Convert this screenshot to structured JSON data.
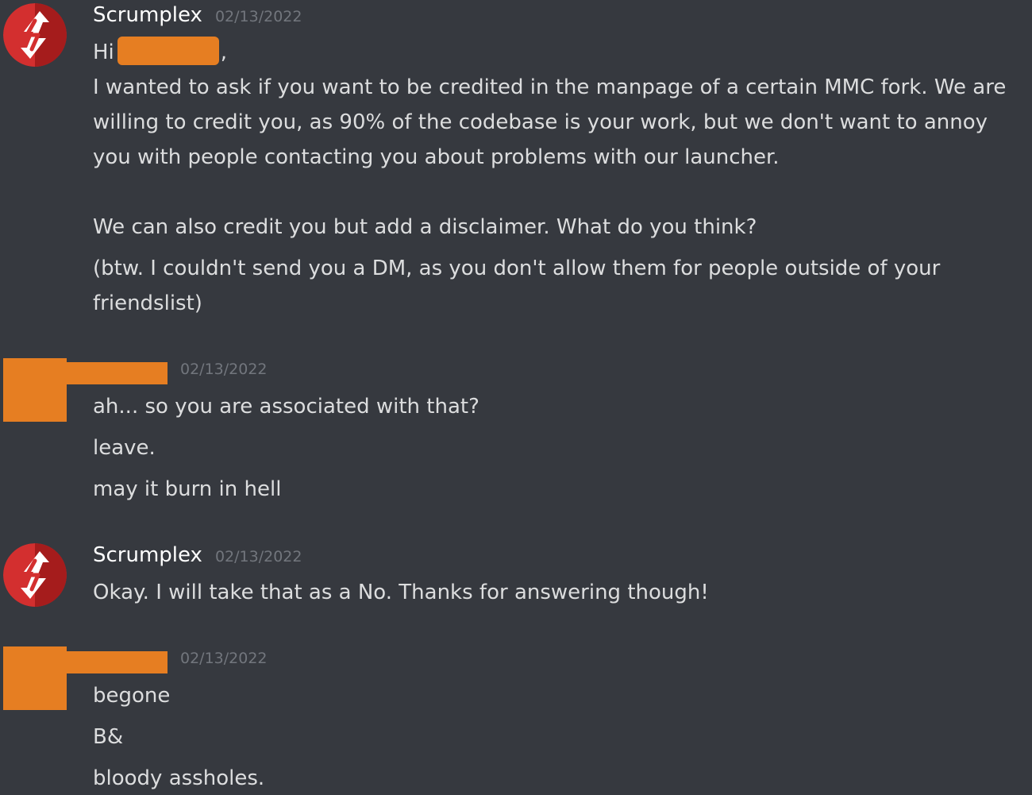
{
  "messages": [
    {
      "author": "Scrumplex",
      "timestamp": "02/13/2022",
      "greeting_prefix": "Hi",
      "greeting_suffix": ",",
      "paragraph1": "I wanted to ask if you want to be credited in the manpage of a certain MMC fork. We are willing to credit you, as 90% of the codebase is your work, but we don't want to annoy you with people contacting you about problems with our launcher.",
      "paragraph2": "We can also credit you but add a disclaimer. What do you think?",
      "paragraph3": "(btw. I couldn't send you a DM, as you don't allow them for people outside of your friendslist)"
    },
    {
      "author": "",
      "timestamp": "02/13/2022",
      "lines": [
        "ah... so you are associated with that?",
        "leave.",
        "may it burn in hell"
      ]
    },
    {
      "author": "Scrumplex",
      "timestamp": "02/13/2022",
      "lines": [
        "Okay. I will take that as a No. Thanks for answering though!"
      ]
    },
    {
      "author": "",
      "timestamp": "02/13/2022",
      "lines": [
        "begone",
        "B&",
        "bloody assholes."
      ]
    }
  ],
  "colors": {
    "background": "#36393f",
    "redaction": "#e67e22",
    "avatar_red": "#d32f2f",
    "username": "#ffffff",
    "timestamp": "#72767d",
    "text": "#dcddde"
  },
  "icons": {
    "scrumplex_avatar": "lightning-s-logo-icon"
  }
}
